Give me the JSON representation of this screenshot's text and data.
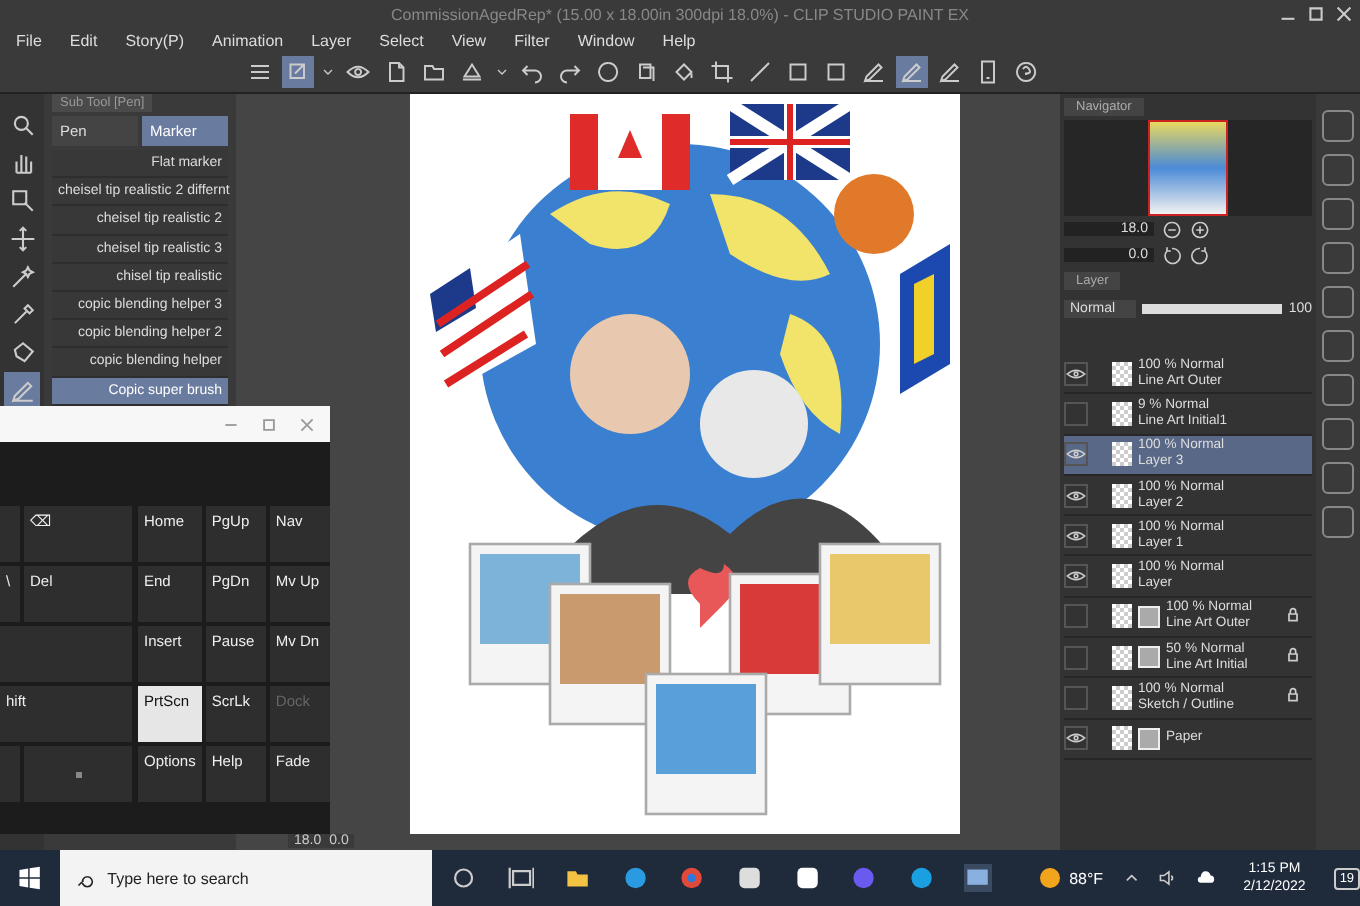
{
  "window": {
    "title": "CommissionAgedRep* (15.00 x 18.00in 300dpi 18.0%) - CLIP STUDIO PAINT EX"
  },
  "menu": [
    "File",
    "Edit",
    "Story(P)",
    "Animation",
    "Layer",
    "Select",
    "View",
    "Filter",
    "Window",
    "Help"
  ],
  "toolbar": [
    {
      "kind": "menu",
      "selected": false
    },
    {
      "kind": "layer",
      "selected": true
    },
    {
      "kind": "caret",
      "selected": false
    },
    {
      "kind": "eye",
      "selected": false
    },
    {
      "kind": "new-file",
      "selected": false
    },
    {
      "kind": "folder",
      "selected": false
    },
    {
      "kind": "triangle",
      "selected": false
    },
    {
      "kind": "caret",
      "selected": false
    },
    {
      "kind": "undo",
      "selected": false
    },
    {
      "kind": "redo",
      "selected": false
    },
    {
      "kind": "circle",
      "selected": false
    },
    {
      "kind": "copy",
      "selected": false
    },
    {
      "kind": "diamond",
      "selected": false
    },
    {
      "kind": "crop",
      "selected": false
    },
    {
      "kind": "line",
      "selected": false
    },
    {
      "kind": "square",
      "selected": false
    },
    {
      "kind": "square",
      "selected": false
    },
    {
      "kind": "pen",
      "selected": false
    },
    {
      "kind": "pen",
      "selected": true
    },
    {
      "kind": "pen",
      "selected": false
    },
    {
      "kind": "phone",
      "selected": false
    },
    {
      "kind": "help",
      "selected": false
    }
  ],
  "tools": [
    {
      "kind": "search",
      "selected": false
    },
    {
      "kind": "hand",
      "selected": false
    },
    {
      "kind": "select",
      "selected": false
    },
    {
      "kind": "move",
      "selected": false
    },
    {
      "kind": "wand",
      "selected": false
    },
    {
      "kind": "dropper",
      "selected": false
    },
    {
      "kind": "lasso",
      "selected": false
    },
    {
      "kind": "pen",
      "selected": true
    }
  ],
  "sub_tool": {
    "title": "Sub Tool [Pen]",
    "tabs": [
      {
        "label": "Pen",
        "selected": false
      },
      {
        "label": "Marker",
        "selected": true
      }
    ],
    "items": [
      {
        "label": "Flat marker",
        "selected": false
      },
      {
        "label": "cheisel tip realistic 2 differnt",
        "selected": false
      },
      {
        "label": "cheisel tip realistic 2",
        "selected": false
      },
      {
        "label": "cheisel tip realistic 3",
        "selected": false
      },
      {
        "label": "chisel tip realistic",
        "selected": false
      },
      {
        "label": "copic blending helper 3",
        "selected": false
      },
      {
        "label": "copic blending helper 2",
        "selected": false
      },
      {
        "label": "copic blending helper",
        "selected": false
      },
      {
        "label": "Copic super brush",
        "selected": true
      }
    ]
  },
  "canvas_status": {
    "zoom": "18.0",
    "angle": "0.0"
  },
  "navigator": {
    "title": "Navigator",
    "zoom": "18.0",
    "angle": "0.0"
  },
  "layer_panel": {
    "title": "Layer",
    "blend_mode": "Normal",
    "opacity": "100",
    "opacity_slider": {
      "level": 1
    },
    "layers": [
      {
        "mode": "100 % Normal",
        "name": "Line Art Outer",
        "visible": true,
        "selected": false,
        "mask": false,
        "locked": false
      },
      {
        "mode": "9 % Normal",
        "name": "Line Art Initial1",
        "visible": false,
        "selected": false,
        "mask": false,
        "locked": false
      },
      {
        "mode": "100 % Normal",
        "name": "Layer 3",
        "visible": true,
        "selected": true,
        "mask": false,
        "locked": false
      },
      {
        "mode": "100 % Normal",
        "name": "Layer 2",
        "visible": true,
        "selected": false,
        "mask": false,
        "locked": false
      },
      {
        "mode": "100 % Normal",
        "name": "Layer 1",
        "visible": true,
        "selected": false,
        "mask": false,
        "locked": false
      },
      {
        "mode": "100 % Normal",
        "name": "Layer",
        "visible": true,
        "selected": false,
        "mask": false,
        "locked": false
      },
      {
        "mode": "100 % Normal",
        "name": "Line Art Outer",
        "visible": false,
        "selected": false,
        "mask": true,
        "locked": true
      },
      {
        "mode": "50 % Normal",
        "name": "Line Art Initial",
        "visible": false,
        "selected": false,
        "mask": true,
        "locked": true
      },
      {
        "mode": "100 % Normal",
        "name": "Sketch / Outline",
        "visible": false,
        "selected": false,
        "mask": false,
        "locked": true
      },
      {
        "name": "Paper",
        "visible": true,
        "selected": false,
        "mask": true,
        "locked": false
      }
    ]
  },
  "keyboard": {
    "keys": [
      {
        "kind": "narrow"
      },
      {
        "label": "⌫",
        "kind": "wide"
      },
      {
        "label": "\\",
        "kind": "narrow"
      },
      {
        "label": "Del",
        "kind": "wide"
      },
      {
        "kind": "full"
      },
      {
        "label": "hift",
        "kind": "full"
      },
      {
        "kind": "narrow"
      },
      {
        "kind": "dot"
      }
    ],
    "nav_keys": [
      {
        "label": "Home",
        "pressed": false,
        "disabled": false
      },
      {
        "label": "PgUp",
        "pressed": false,
        "disabled": false
      },
      {
        "label": "Nav",
        "pressed": false,
        "disabled": false
      },
      {
        "label": "End",
        "pressed": false,
        "disabled": false
      },
      {
        "label": "PgDn",
        "pressed": false,
        "disabled": false
      },
      {
        "label": "Mv Up",
        "pressed": false,
        "disabled": false
      },
      {
        "label": "Insert",
        "pressed": false,
        "disabled": false
      },
      {
        "label": "Pause",
        "pressed": false,
        "disabled": false
      },
      {
        "label": "Mv Dn",
        "pressed": false,
        "disabled": false
      },
      {
        "label": "PrtScn",
        "pressed": true,
        "disabled": false
      },
      {
        "label": "ScrLk",
        "pressed": false,
        "disabled": false
      },
      {
        "label": "Dock",
        "pressed": false,
        "disabled": true
      },
      {
        "label": "Options",
        "pressed": false,
        "disabled": false
      },
      {
        "label": "Help",
        "pressed": false,
        "disabled": false
      },
      {
        "label": "Fade",
        "pressed": false,
        "disabled": false
      }
    ]
  },
  "taskbar": {
    "search_placeholder": "Type here to search",
    "weather": "88°F",
    "time": "1:15 PM",
    "date": "2/12/2022",
    "notifications": "19"
  }
}
